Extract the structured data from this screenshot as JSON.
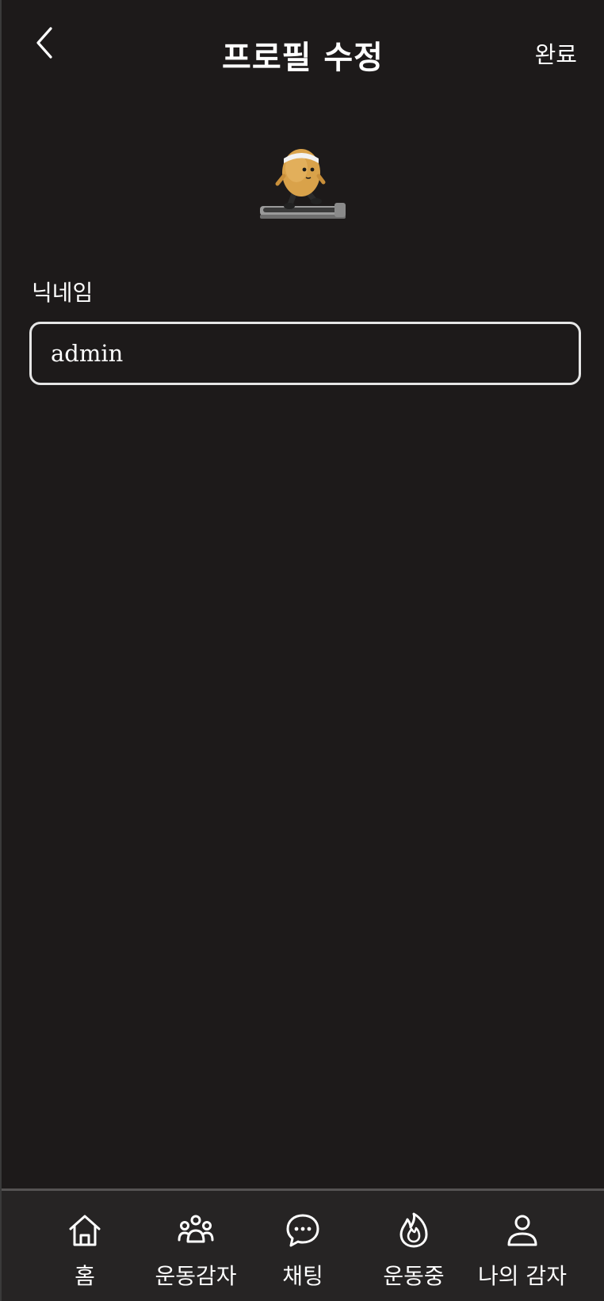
{
  "header": {
    "title": "프로필 수정",
    "done_label": "완료"
  },
  "profile": {
    "nickname_label": "닉네임",
    "nickname_value": "admin"
  },
  "tabbar": {
    "items": [
      {
        "label": "홈",
        "icon": "home-icon"
      },
      {
        "label": "운동감자",
        "icon": "group-icon"
      },
      {
        "label": "채팅",
        "icon": "chat-bubble-icon"
      },
      {
        "label": "운동중",
        "icon": "flame-icon"
      },
      {
        "label": "나의 감자",
        "icon": "person-icon"
      }
    ]
  },
  "colors": {
    "background": "#1d1a1a",
    "tabbar_background": "#262424",
    "input_border": "#e6e6e6",
    "text": "#ffffff"
  }
}
